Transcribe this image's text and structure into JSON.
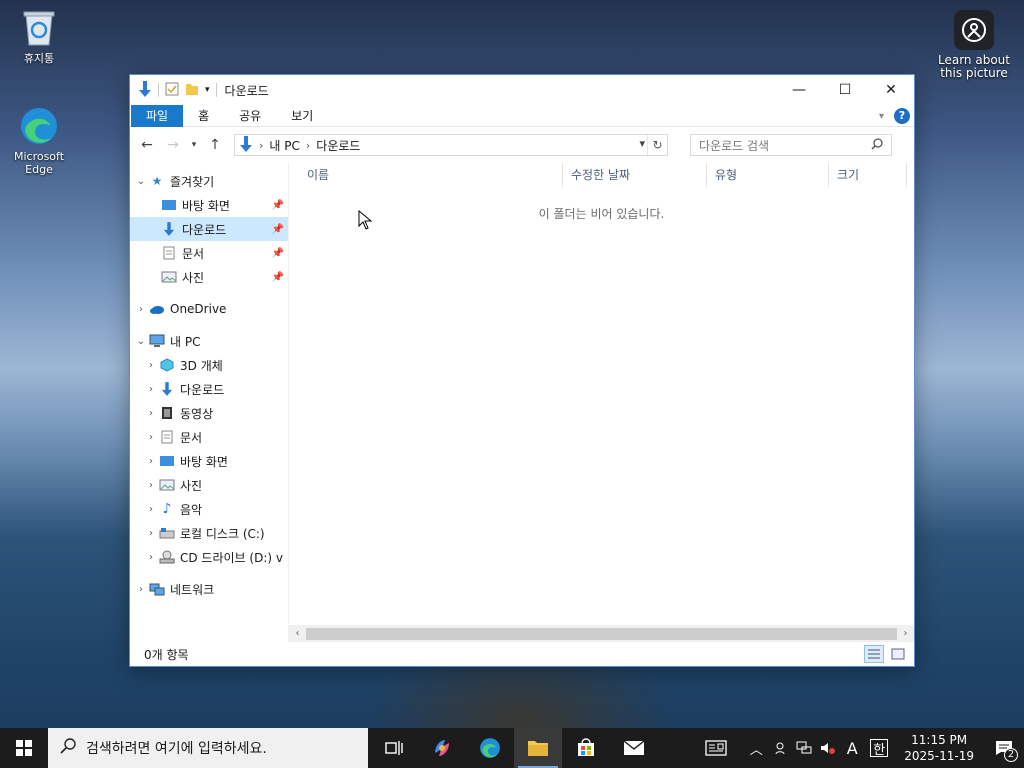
{
  "desktop": {
    "icons": [
      {
        "name": "recycle-bin",
        "label": "휴지통"
      },
      {
        "name": "edge",
        "label": "Microsoft Edge"
      }
    ],
    "learn": "Learn about this picture"
  },
  "window": {
    "title": "다운로드",
    "ribbon_tabs": [
      "파일",
      "홈",
      "공유",
      "보기"
    ],
    "address": {
      "segments": [
        "내 PC",
        "다운로드"
      ]
    },
    "search_placeholder": "다운로드 검색",
    "nav": {
      "quick_access": "즐겨찾기",
      "quick_items": [
        "바탕 화면",
        "다운로드",
        "문서",
        "사진"
      ],
      "onedrive": "OneDrive",
      "this_pc": "내 PC",
      "pc_items": [
        "3D 개체",
        "다운로드",
        "동영상",
        "문서",
        "바탕 화면",
        "사진",
        "음악",
        "로컬 디스크 (C:)",
        "CD 드라이브 (D:) v"
      ],
      "network": "네트워크"
    },
    "columns": [
      "이름",
      "수정한 날짜",
      "유형",
      "크기"
    ],
    "empty_message": "이 폴더는 비어 있습니다.",
    "status": "0개 항목"
  },
  "taskbar": {
    "search_placeholder": "검색하려면 여기에 입력하세요.",
    "tray": {
      "ime1": "A",
      "ime2": "한",
      "time": "11:15 PM",
      "date": "2025-11-19",
      "notif_count": "2"
    }
  },
  "colors": {
    "accent": "#1979ca",
    "selection": "#cce8ff",
    "taskbar": "#1c1c1c"
  }
}
